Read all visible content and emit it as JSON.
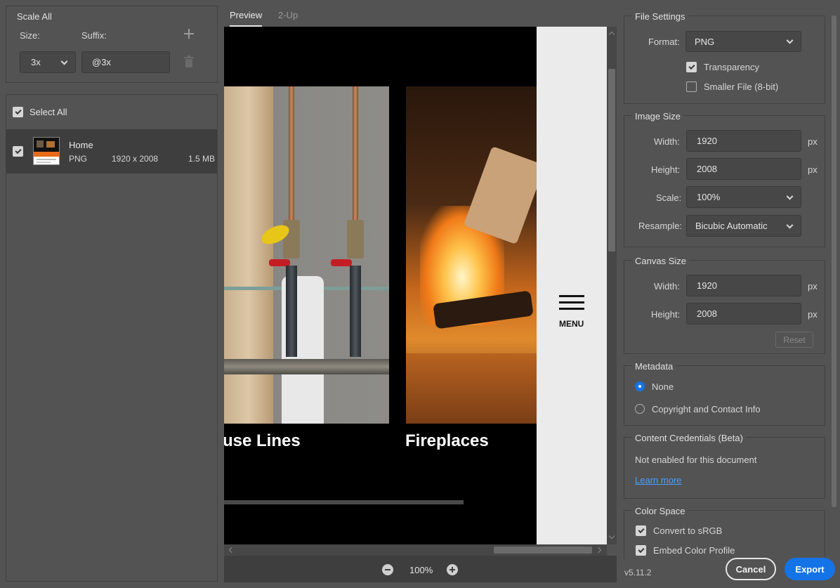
{
  "left": {
    "scale_all": "Scale All",
    "size_label": "Size:",
    "suffix_label": "Suffix:",
    "size_value": "3x",
    "suffix_value": "@3x",
    "select_all": "Select All",
    "asset": {
      "name": "Home",
      "format": "PNG",
      "dimensions": "1920 x 2008",
      "filesize": "1.5 MB"
    }
  },
  "tabs": {
    "preview": "Preview",
    "twoup": "2-Up"
  },
  "preview": {
    "caption_left": "use Lines",
    "caption_right": "Fireplaces",
    "menu": "MENU"
  },
  "zoom": {
    "level": "100%"
  },
  "file_settings": {
    "title": "File Settings",
    "format_label": "Format:",
    "format_value": "PNG",
    "transparency": "Transparency",
    "smaller_file": "Smaller File (8-bit)"
  },
  "image_size": {
    "title": "Image Size",
    "width_label": "Width:",
    "width_value": "1920",
    "height_label": "Height:",
    "height_value": "2008",
    "scale_label": "Scale:",
    "scale_value": "100%",
    "resample_label": "Resample:",
    "resample_value": "Bicubic Automatic",
    "unit": "px"
  },
  "canvas_size": {
    "title": "Canvas Size",
    "width_label": "Width:",
    "width_value": "1920",
    "height_label": "Height:",
    "height_value": "2008",
    "unit": "px",
    "reset": "Reset"
  },
  "metadata": {
    "title": "Metadata",
    "none": "None",
    "copyright": "Copyright and Contact Info"
  },
  "credentials": {
    "title": "Content Credentials (Beta)",
    "status": "Not enabled for this document",
    "learn_more": "Learn more"
  },
  "color_space": {
    "title": "Color Space",
    "convert": "Convert to sRGB",
    "embed": "Embed Color Profile"
  },
  "footer": {
    "version": "v5.11.2",
    "cancel": "Cancel",
    "export": "Export"
  },
  "colors": {
    "accent": "#1473e6",
    "panel": "#535353",
    "field": "#474747",
    "border": "#414141"
  }
}
